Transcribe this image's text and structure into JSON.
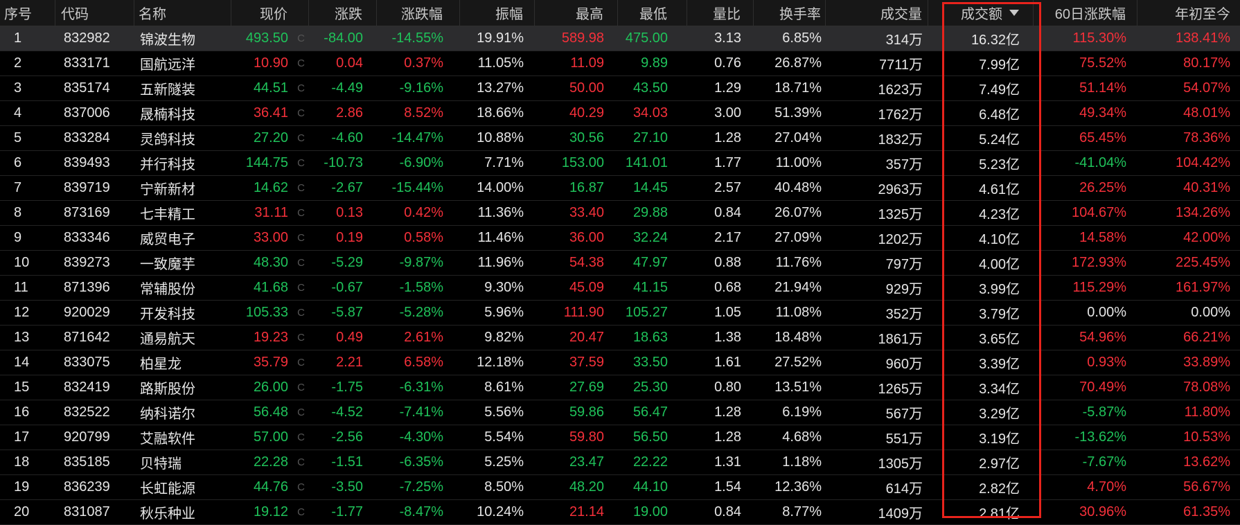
{
  "table": {
    "headers": {
      "idx": "序号",
      "code": "代码",
      "name": "名称",
      "price": "现价",
      "chg": "涨跌",
      "pct": "涨跌幅",
      "amp": "振幅",
      "high": "最高",
      "low": "最低",
      "vr": "量比",
      "turn": "换手率",
      "vol": "成交量",
      "amt": "成交额",
      "d60": "60日涨跌幅",
      "ytd": "年初至今"
    },
    "sort_column": "成交额",
    "sort_direction": "descending",
    "selected_row": 1,
    "price_suffix_glyph": "C",
    "colors": {
      "up": "#f5303a",
      "down": "#1fc25a",
      "neutral": "#e6e6e6",
      "highlight_box": "#e8231c",
      "background": "#000000",
      "selected_row": "#2c2c2e"
    },
    "rows": [
      {
        "idx": "1",
        "code": "832982",
        "name": "锦波生物",
        "price": "493.50",
        "chg": "-84.00",
        "pct": "-14.55%",
        "amp": "19.91%",
        "high": "589.98",
        "low": "475.00",
        "vr": "3.13",
        "turn": "6.85%",
        "vol": "314万",
        "amt": "16.32亿",
        "d60": "115.30%",
        "ytd": "138.41%"
      },
      {
        "idx": "2",
        "code": "833171",
        "name": "国航远洋",
        "price": "10.90",
        "chg": "0.04",
        "pct": "0.37%",
        "amp": "11.05%",
        "high": "11.09",
        "low": "9.89",
        "vr": "0.76",
        "turn": "26.87%",
        "vol": "7711万",
        "amt": "7.99亿",
        "d60": "75.52%",
        "ytd": "80.17%"
      },
      {
        "idx": "3",
        "code": "835174",
        "name": "五新隧装",
        "price": "44.51",
        "chg": "-4.49",
        "pct": "-9.16%",
        "amp": "13.27%",
        "high": "50.00",
        "low": "43.50",
        "vr": "1.29",
        "turn": "18.71%",
        "vol": "1623万",
        "amt": "7.49亿",
        "d60": "51.14%",
        "ytd": "54.07%"
      },
      {
        "idx": "4",
        "code": "837006",
        "name": "晟楠科技",
        "price": "36.41",
        "chg": "2.86",
        "pct": "8.52%",
        "amp": "18.66%",
        "high": "40.29",
        "low": "34.03",
        "vr": "3.00",
        "turn": "51.39%",
        "vol": "1762万",
        "amt": "6.48亿",
        "d60": "49.34%",
        "ytd": "48.01%"
      },
      {
        "idx": "5",
        "code": "833284",
        "name": "灵鸽科技",
        "price": "27.20",
        "chg": "-4.60",
        "pct": "-14.47%",
        "amp": "10.88%",
        "high": "30.56",
        "low": "27.10",
        "vr": "1.28",
        "turn": "27.04%",
        "vol": "1832万",
        "amt": "5.24亿",
        "d60": "65.45%",
        "ytd": "78.36%"
      },
      {
        "idx": "6",
        "code": "839493",
        "name": "并行科技",
        "price": "144.75",
        "chg": "-10.73",
        "pct": "-6.90%",
        "amp": "7.71%",
        "high": "153.00",
        "low": "141.01",
        "vr": "1.77",
        "turn": "11.00%",
        "vol": "357万",
        "amt": "5.23亿",
        "d60": "-41.04%",
        "ytd": "104.42%"
      },
      {
        "idx": "7",
        "code": "839719",
        "name": "宁新新材",
        "price": "14.62",
        "chg": "-2.67",
        "pct": "-15.44%",
        "amp": "14.00%",
        "high": "16.87",
        "low": "14.45",
        "vr": "2.57",
        "turn": "40.48%",
        "vol": "2963万",
        "amt": "4.61亿",
        "d60": "26.25%",
        "ytd": "40.31%"
      },
      {
        "idx": "8",
        "code": "873169",
        "name": "七丰精工",
        "price": "31.11",
        "chg": "0.13",
        "pct": "0.42%",
        "amp": "11.36%",
        "high": "33.40",
        "low": "29.88",
        "vr": "0.84",
        "turn": "26.07%",
        "vol": "1325万",
        "amt": "4.23亿",
        "d60": "104.67%",
        "ytd": "134.26%"
      },
      {
        "idx": "9",
        "code": "833346",
        "name": "威贸电子",
        "price": "33.00",
        "chg": "0.19",
        "pct": "0.58%",
        "amp": "11.46%",
        "high": "36.00",
        "low": "32.24",
        "vr": "2.17",
        "turn": "27.09%",
        "vol": "1202万",
        "amt": "4.10亿",
        "d60": "14.58%",
        "ytd": "42.00%"
      },
      {
        "idx": "10",
        "code": "839273",
        "name": "一致魔芋",
        "price": "48.30",
        "chg": "-5.29",
        "pct": "-9.87%",
        "amp": "11.96%",
        "high": "54.38",
        "low": "47.97",
        "vr": "0.88",
        "turn": "11.76%",
        "vol": "797万",
        "amt": "4.00亿",
        "d60": "172.93%",
        "ytd": "225.45%"
      },
      {
        "idx": "11",
        "code": "871396",
        "name": "常辅股份",
        "price": "41.68",
        "chg": "-0.67",
        "pct": "-1.58%",
        "amp": "9.30%",
        "high": "45.09",
        "low": "41.15",
        "vr": "0.68",
        "turn": "21.94%",
        "vol": "929万",
        "amt": "3.99亿",
        "d60": "115.29%",
        "ytd": "161.97%"
      },
      {
        "idx": "12",
        "code": "920029",
        "name": "开发科技",
        "price": "105.33",
        "chg": "-5.87",
        "pct": "-5.28%",
        "amp": "5.96%",
        "high": "111.90",
        "low": "105.27",
        "vr": "1.05",
        "turn": "11.08%",
        "vol": "352万",
        "amt": "3.79亿",
        "d60": "0.00%",
        "ytd": "0.00%"
      },
      {
        "idx": "13",
        "code": "871642",
        "name": "通易航天",
        "price": "19.23",
        "chg": "0.49",
        "pct": "2.61%",
        "amp": "9.82%",
        "high": "20.47",
        "low": "18.63",
        "vr": "1.38",
        "turn": "18.48%",
        "vol": "1861万",
        "amt": "3.65亿",
        "d60": "54.96%",
        "ytd": "66.21%"
      },
      {
        "idx": "14",
        "code": "833075",
        "name": "柏星龙",
        "price": "35.79",
        "chg": "2.21",
        "pct": "6.58%",
        "amp": "12.18%",
        "high": "37.59",
        "low": "33.50",
        "vr": "1.61",
        "turn": "27.52%",
        "vol": "960万",
        "amt": "3.39亿",
        "d60": "0.93%",
        "ytd": "33.89%"
      },
      {
        "idx": "15",
        "code": "832419",
        "name": "路斯股份",
        "price": "26.00",
        "chg": "-1.75",
        "pct": "-6.31%",
        "amp": "8.61%",
        "high": "27.69",
        "low": "25.30",
        "vr": "0.80",
        "turn": "13.51%",
        "vol": "1265万",
        "amt": "3.34亿",
        "d60": "70.49%",
        "ytd": "78.08%"
      },
      {
        "idx": "16",
        "code": "832522",
        "name": "纳科诺尔",
        "price": "56.48",
        "chg": "-4.52",
        "pct": "-7.41%",
        "amp": "5.56%",
        "high": "59.86",
        "low": "56.47",
        "vr": "1.28",
        "turn": "6.19%",
        "vol": "567万",
        "amt": "3.29亿",
        "d60": "-5.87%",
        "ytd": "11.80%"
      },
      {
        "idx": "17",
        "code": "920799",
        "name": "艾融软件",
        "price": "57.00",
        "chg": "-2.56",
        "pct": "-4.30%",
        "amp": "5.54%",
        "high": "59.80",
        "low": "56.50",
        "vr": "1.28",
        "turn": "4.68%",
        "vol": "551万",
        "amt": "3.19亿",
        "d60": "-13.62%",
        "ytd": "10.53%"
      },
      {
        "idx": "18",
        "code": "835185",
        "name": "贝特瑞",
        "price": "22.28",
        "chg": "-1.51",
        "pct": "-6.35%",
        "amp": "5.25%",
        "high": "23.47",
        "low": "22.22",
        "vr": "1.31",
        "turn": "1.18%",
        "vol": "1305万",
        "amt": "2.97亿",
        "d60": "-7.67%",
        "ytd": "13.62%"
      },
      {
        "idx": "19",
        "code": "836239",
        "name": "长虹能源",
        "price": "44.76",
        "chg": "-3.50",
        "pct": "-7.25%",
        "amp": "8.50%",
        "high": "48.20",
        "low": "44.10",
        "vr": "1.54",
        "turn": "12.36%",
        "vol": "614万",
        "amt": "2.82亿",
        "d60": "4.70%",
        "ytd": "56.67%"
      },
      {
        "idx": "20",
        "code": "831087",
        "name": "秋乐种业",
        "price": "19.12",
        "chg": "-1.77",
        "pct": "-8.47%",
        "amp": "10.24%",
        "high": "21.14",
        "low": "19.00",
        "vr": "0.84",
        "turn": "8.77%",
        "vol": "1409万",
        "amt": "2.81亿",
        "d60": "30.96%",
        "ytd": "61.35%"
      }
    ]
  }
}
